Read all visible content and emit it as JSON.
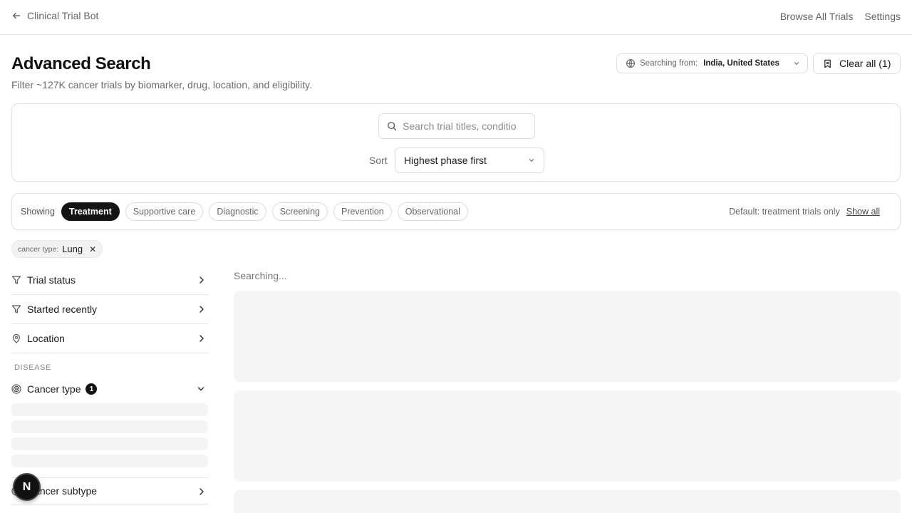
{
  "header": {
    "back_label": "Clinical Trial Bot",
    "nav": [
      "Browse All Trials",
      "Settings"
    ]
  },
  "page": {
    "title": "Advanced Search",
    "subtitle": "Filter ~127K cancer trials by biomarker, drug, location, and eligibility."
  },
  "searching_from": {
    "label": "Searching from:",
    "value": "India, United States"
  },
  "clear_all": {
    "label": "Clear all (1)"
  },
  "search": {
    "placeholder": "Search trial titles, conditions",
    "value": ""
  },
  "sort": {
    "label": "Sort",
    "selected": "Highest phase first"
  },
  "purpose_filter": {
    "showing_label": "Showing",
    "chips": [
      "Treatment",
      "Supportive care",
      "Diagnostic",
      "Screening",
      "Prevention",
      "Observational"
    ],
    "active": "Treatment",
    "default_note": "Default: treatment trials only",
    "show_all_label": "Show all"
  },
  "active_filters": [
    {
      "key": "cancer type:",
      "value": "Lung"
    }
  ],
  "sidebar": {
    "groups": [
      {
        "label": "Trial status",
        "icon": "filter-icon"
      },
      {
        "label": "Started recently",
        "icon": "filter-icon"
      },
      {
        "label": "Location",
        "icon": "map-pin-icon"
      }
    ],
    "section_label": "DISEASE",
    "cancer_type": {
      "label": "Cancer type",
      "count": "1",
      "icon": "target-icon"
    },
    "cancer_subtype": {
      "label": "Cancer subtype",
      "icon": "target-icon"
    }
  },
  "fab_label": "N",
  "results": {
    "status": "Searching..."
  },
  "colors": {
    "accent": "#141414",
    "muted_text": "#6b6b6b",
    "border": "#e2e2e2",
    "skeleton": "#f5f5f5"
  }
}
